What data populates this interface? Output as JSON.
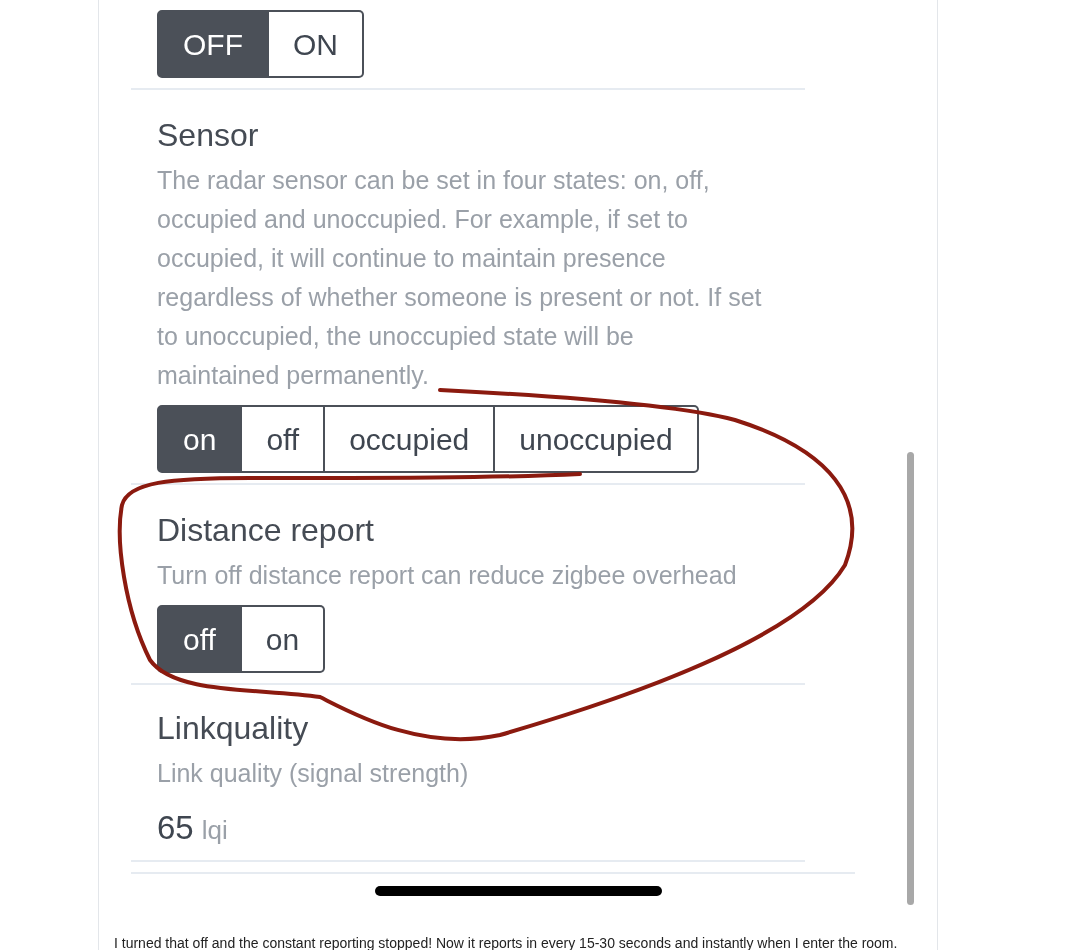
{
  "sections": [
    {
      "options": [
        {
          "label": "OFF",
          "selected": true
        },
        {
          "label": "ON",
          "selected": false
        }
      ]
    },
    {
      "title": "Sensor",
      "description": "The radar sensor can be set in four states: on, off, occupied and unoccupied. For example, if set to occupied, it will continue to maintain presence regardless of whether someone is present or not. If set to unoccupied, the unoccupied state will be maintained permanently.",
      "options": [
        {
          "label": "on",
          "selected": true
        },
        {
          "label": "off",
          "selected": false
        },
        {
          "label": "occupied",
          "selected": false
        },
        {
          "label": "unoccupied",
          "selected": false
        }
      ]
    },
    {
      "title": "Distance report",
      "description": "Turn off distance report can reduce zigbee overhead",
      "options": [
        {
          "label": "off",
          "selected": true
        },
        {
          "label": "on",
          "selected": false
        }
      ]
    },
    {
      "title": "Linkquality",
      "description": "Link quality (signal strength)",
      "value": "65",
      "unit": "lqi"
    }
  ],
  "post_text": "I turned that off and the constant reporting stopped! Now it reports in every 15-30 seconds and instantly when I enter the room."
}
